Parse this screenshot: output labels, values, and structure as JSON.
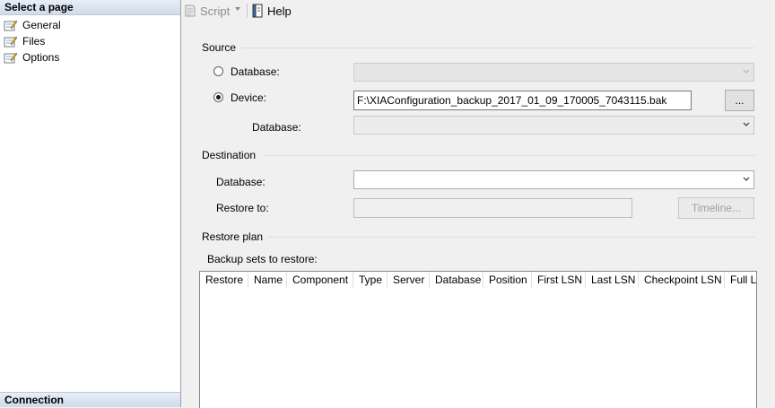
{
  "left_pane": {
    "header": "Select a page",
    "items": [
      {
        "label": "General",
        "icon": "page-settings-icon"
      },
      {
        "label": "Files",
        "icon": "page-settings-icon"
      },
      {
        "label": "Options",
        "icon": "page-settings-icon"
      }
    ],
    "connection_header": "Connection"
  },
  "toolbar": {
    "script_label": "Script",
    "help_label": "Help"
  },
  "source": {
    "title": "Source",
    "database_option_label": "Database:",
    "device_option_label": "Device:",
    "selected_option": "device",
    "device_path": "F:\\XIAConfiguration_backup_2017_01_09_170005_7043115.bak",
    "browse_label": "...",
    "database_label": "Database:",
    "database_value": ""
  },
  "destination": {
    "title": "Destination",
    "database_label": "Database:",
    "database_value": "",
    "restore_to_label": "Restore to:",
    "restore_to_value": "",
    "timeline_label": "Timeline..."
  },
  "restore_plan": {
    "title": "Restore plan",
    "backup_sets_label": "Backup sets to restore:",
    "columns": [
      "Restore",
      "Name",
      "Component",
      "Type",
      "Server",
      "Database",
      "Position",
      "First LSN",
      "Last LSN",
      "Checkpoint LSN",
      "Full LSN"
    ],
    "rows": []
  },
  "colors": {
    "pane_header_gradient": [
      "#e7eef7",
      "#cfdbea"
    ],
    "window_background": "#f0f0f0"
  }
}
